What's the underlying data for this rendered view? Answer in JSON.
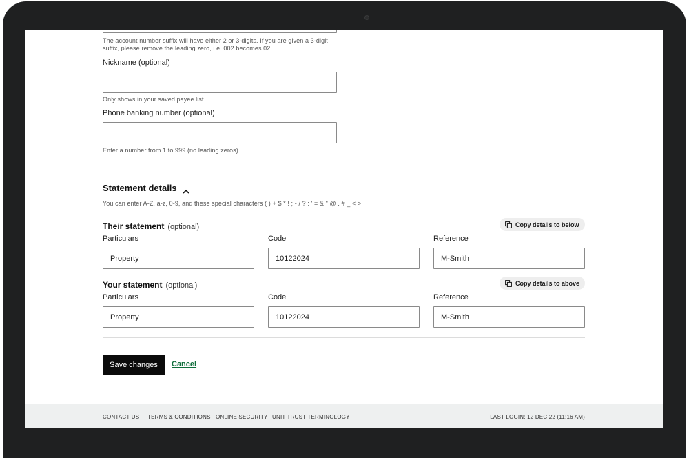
{
  "account_suffix": {
    "help_line1": "The account number suffix will have either 2 or 3-digits. If you are given a 3-digit",
    "help_line2": "suffix, please remove the leading zero, i.e. 002 becomes 02."
  },
  "nickname": {
    "label": "Nickname (optional)",
    "value": "",
    "help": "Only shows in your saved payee list"
  },
  "phone_banking": {
    "label": "Phone banking number (optional)",
    "value": "",
    "help": "Enter a number from 1 to 999 (no leading zeros)"
  },
  "statement_details": {
    "title": "Statement details",
    "help": "You can enter A-Z, a-z, 0-9, and these special characters ( ) + $ * ! ; - / ? : ' = & \" @ . # _ < >",
    "their": {
      "title": "Their statement",
      "optional": "(optional)",
      "copy_label": "Copy details to below",
      "particulars_label": "Particulars",
      "particulars_value": "Property",
      "code_label": "Code",
      "code_value": "10122024",
      "reference_label": "Reference",
      "reference_value": "M-Smith"
    },
    "yours": {
      "title": "Your statement",
      "optional": "(optional)",
      "copy_label": "Copy details to above",
      "particulars_label": "Particulars",
      "particulars_value": "Property",
      "code_label": "Code",
      "code_value": "10122024",
      "reference_label": "Reference",
      "reference_value": "M-Smith"
    }
  },
  "actions": {
    "save_label": "Save changes",
    "cancel_label": "Cancel"
  },
  "footer": {
    "links": [
      "CONTACT US",
      "TERMS & CONDITIONS",
      "ONLINE SECURITY",
      "UNIT TRUST TERMINOLOGY"
    ],
    "last_login": "LAST LOGIN: 12 DEC 22 (11:16 AM)"
  },
  "colors": {
    "accent_link": "#0f6e3b",
    "primary_button": "#0b0b0b",
    "footer_bg": "#eef0f0"
  },
  "icons": {
    "collapse": "chevron-up-icon",
    "copy": "copy-icon"
  }
}
